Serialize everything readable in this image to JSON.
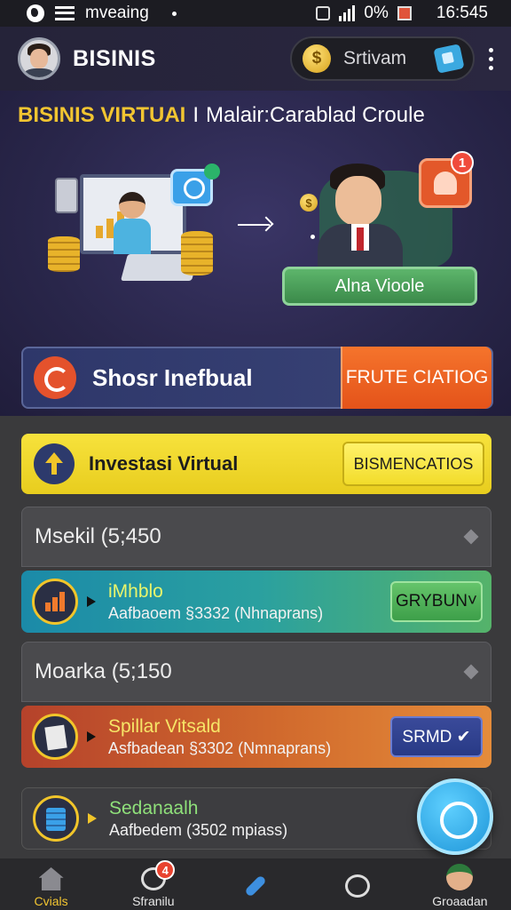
{
  "status_bar": {
    "app_label": "mveaing",
    "battery": "0%",
    "time": "16:545"
  },
  "app_bar": {
    "title": "BISINIS",
    "pill_label": "Srtivam",
    "pill_coin_symbol": "$"
  },
  "hero": {
    "title_highlight": "BISINIS VIRTUAI",
    "title_separator": "I",
    "title_rest": "Malair:Carablad Croule",
    "profile_button": "Alna Vioole",
    "notification_count": "1",
    "coin_symbol": "$",
    "cta_label": "Shosr Inefbual",
    "cta_button": "FRUTE CIATIOG"
  },
  "invest_card": {
    "label": "Investasi Virtual",
    "button": "BISMENCATIOS"
  },
  "sections": [
    {
      "label": "Msekil (5;450"
    },
    {
      "label": "Moarka (5;150"
    }
  ],
  "rows": [
    {
      "title": "iMhblo",
      "subtitle": "Aafbaoem §3332 (Nhnaprans)",
      "button": "GRYBUN˅",
      "accent": "#1b8aa8"
    },
    {
      "title": "Spillar Vitsald",
      "subtitle": "Asfbadean §3302 (Nmnaprans)",
      "button": "SRMD ✔",
      "accent": "#d16a2d"
    },
    {
      "title": "Sedanaalh",
      "subtitle": "Aafbedem (3502 mpiass)",
      "accent": "#3d3d40"
    }
  ],
  "nav": {
    "items": [
      {
        "label": "Cvials",
        "icon": "home-icon"
      },
      {
        "label": "Sfranilu",
        "icon": "cart-icon",
        "badge": "4"
      },
      {
        "label": "",
        "icon": "pin-icon"
      },
      {
        "label": "",
        "icon": "user-icon"
      },
      {
        "label": "Groaadan",
        "icon": "profile-icon"
      }
    ]
  },
  "colors": {
    "accent_yellow": "#f2c531",
    "cta_orange": "#e4531a",
    "fab_blue": "#1e95d8"
  }
}
